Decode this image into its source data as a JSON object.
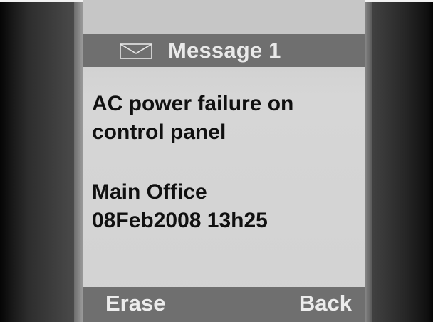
{
  "header": {
    "icon": "envelope-icon",
    "title": "Message 1"
  },
  "message": {
    "lines": [
      "AC power failure on",
      "control panel"
    ]
  },
  "details": {
    "location": "Main Office",
    "timestamp": "08Feb2008 13h25"
  },
  "softkeys": {
    "left_label": "Erase",
    "right_label": "Back"
  },
  "colors": {
    "bar": "#6f6f6f",
    "screen": "#d2d2d2",
    "bar_text": "#e9e9e9",
    "body_text": "#101010"
  }
}
